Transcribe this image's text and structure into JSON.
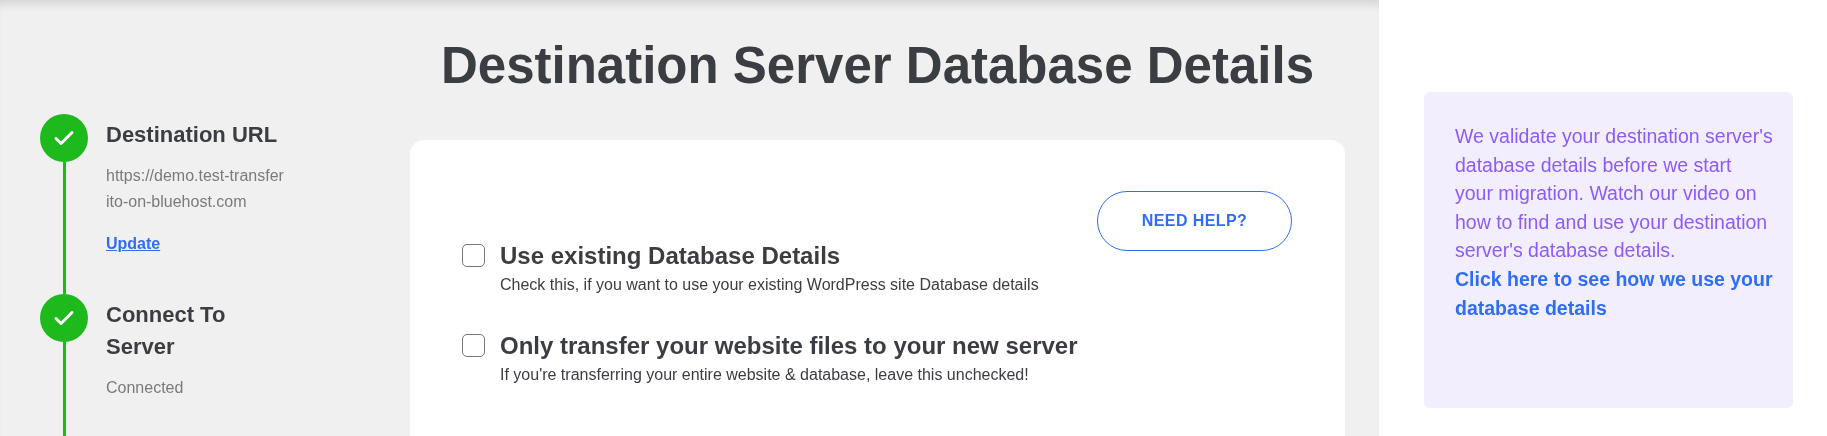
{
  "steps": [
    {
      "title": "Destination URL",
      "detail": "https://demo.test-transferito-on-bluehost.com",
      "link": "Update",
      "done": true
    },
    {
      "title": "Connect To Server",
      "detail": "Connected",
      "done": true
    }
  ],
  "heading": "Destination Server Database Details",
  "help_button": "NEED HELP?",
  "options": [
    {
      "label": "Use existing Database Details",
      "hint": "Check this, if you want to use your existing WordPress site Database details",
      "checked": false
    },
    {
      "label": "Only transfer your website files to your new server",
      "hint": "If you're transferring your entire website & database, leave this unchecked!",
      "checked": false
    }
  ],
  "info": {
    "text": "We validate your destination server's database details before we start your migration. Watch our video on how to find and use your destination server's database details.",
    "link": "Click here to see how we use your database details"
  }
}
